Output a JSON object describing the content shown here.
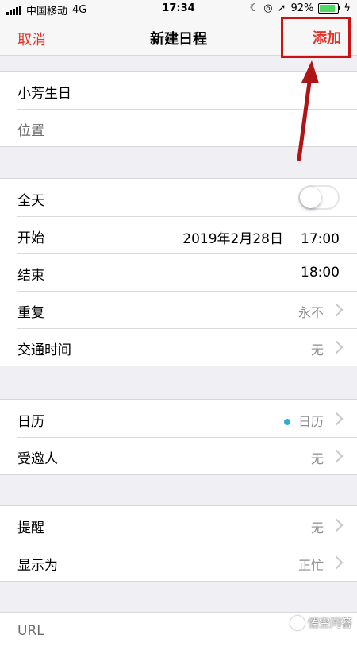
{
  "status_bar": {
    "carrier": "中国移动",
    "network": "4G",
    "time": "17:34",
    "battery": "92%",
    "battery_level": 0.92,
    "accent_color": "#4cd964"
  },
  "nav": {
    "cancel": "取消",
    "title": "新建日程",
    "add": "添加",
    "accent_color": "#e5342c"
  },
  "sections": {
    "title_location": {
      "title": "小芳生日",
      "location_placeholder": "位置"
    },
    "time": {
      "all_day": {
        "label": "全天",
        "toggled": false
      },
      "start": {
        "label": "开始",
        "date": "2019年2月28日",
        "time": "17:00"
      },
      "end": {
        "label": "结束",
        "time": "18:00"
      },
      "repeat": {
        "label": "重复",
        "value": "永不"
      },
      "travel": {
        "label": "交通时间",
        "value": "无"
      }
    },
    "calendar": {
      "calendar": {
        "label": "日历",
        "value": "日历",
        "dot_color": "#34aadc"
      },
      "invitees": {
        "label": "受邀人",
        "value": "无"
      }
    },
    "alerts": {
      "alert": {
        "label": "提醒",
        "value": "无"
      },
      "show_as": {
        "label": "显示为",
        "value": "正忙"
      }
    },
    "url": {
      "label": "URL"
    }
  },
  "annotation": {
    "highlight_color": "#c11111",
    "icon": "red-arrow-icon"
  },
  "watermark": {
    "text": "悟空问答"
  }
}
